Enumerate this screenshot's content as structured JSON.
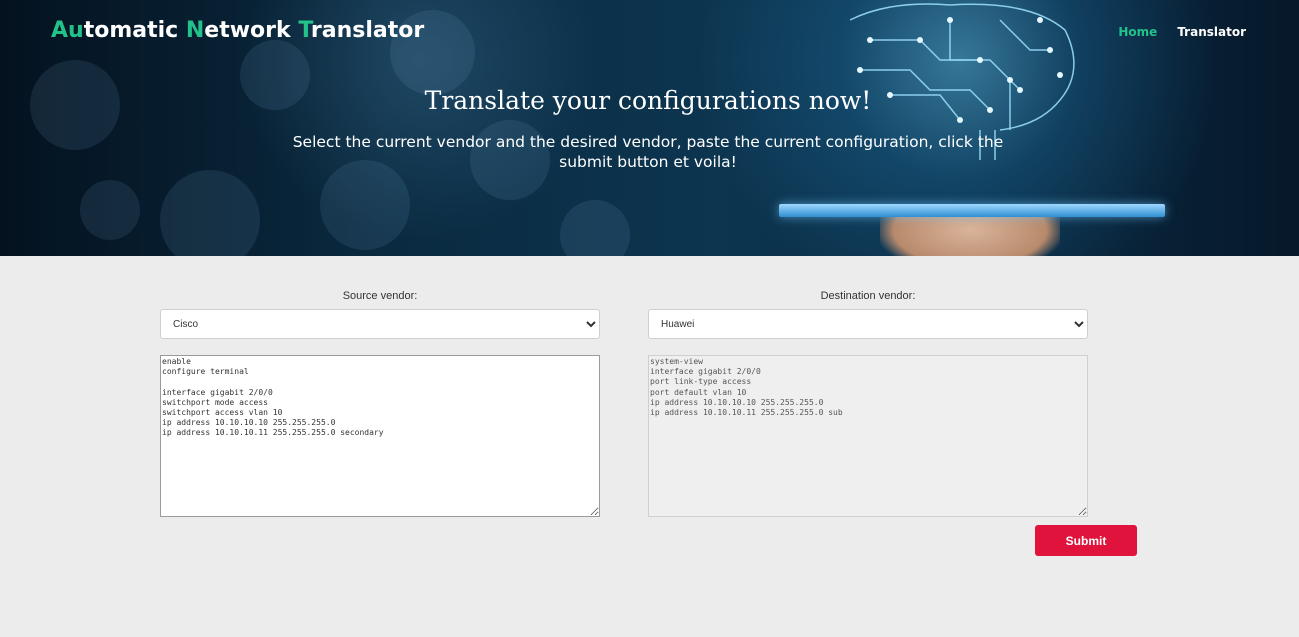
{
  "header": {
    "logo_parts": [
      {
        "text": "Au",
        "accent": true
      },
      {
        "text": "tomatic ",
        "accent": false
      },
      {
        "text": "N",
        "accent": true
      },
      {
        "text": "etwork ",
        "accent": false
      },
      {
        "text": "T",
        "accent": true
      },
      {
        "text": "ranslator",
        "accent": false
      }
    ],
    "nav": [
      {
        "label": "Home",
        "active": true
      },
      {
        "label": "Translator",
        "active": false
      }
    ],
    "title": "Translate your configurations now!",
    "subtitle": "Select the current vendor and the desired vendor, paste the current configuration, click the submit button et voila!"
  },
  "form": {
    "source_label": "Source vendor:",
    "source_selected": "Cisco",
    "destination_label": "Destination vendor:",
    "destination_selected": "Huawei",
    "source_config": "enable\nconfigure terminal\n\ninterface gigabit 2/0/0\nswitchport mode access\nswitchport access vlan 10\nip address 10.10.10.10 255.255.255.0\nip address 10.10.10.11 255.255.255.0 secondary",
    "destination_config": "system-view\ninterface gigabit 2/0/0\nport link-type access\nport default vlan 10\nip address 10.10.10.10 255.255.255.0\nip address 10.10.10.11 255.255.255.0 sub",
    "submit_label": "Submit"
  },
  "colors": {
    "accent": "#22c28a",
    "submit": "#e0133c",
    "background": "#ececec"
  }
}
